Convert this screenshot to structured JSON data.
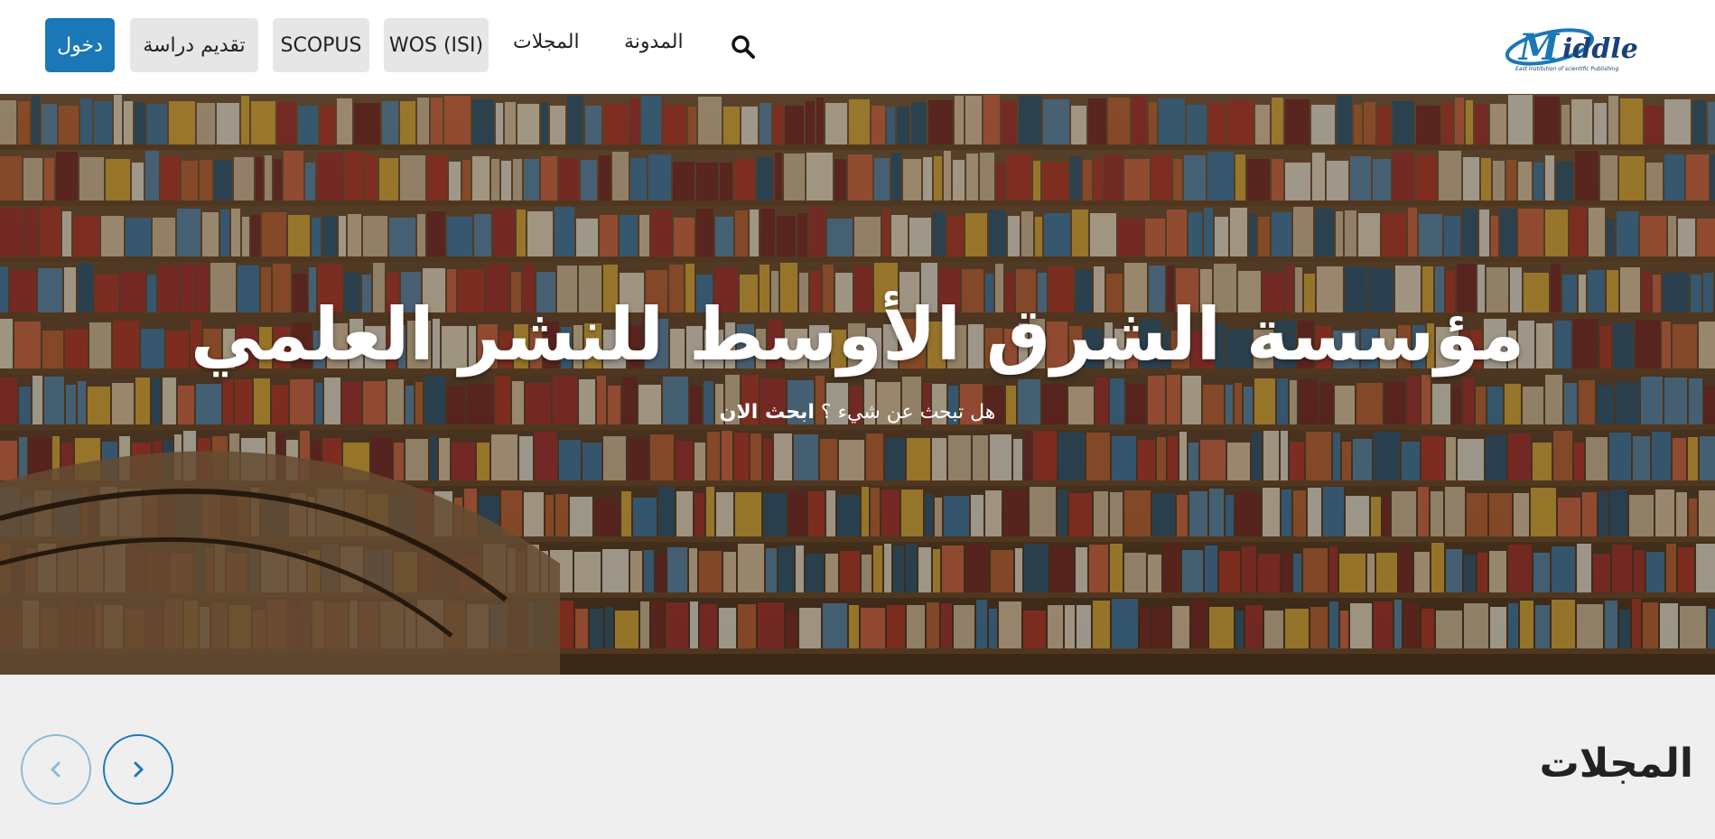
{
  "header": {
    "login_label": "دخول",
    "submit_study_label": "تقديم دراسة",
    "scopus_label": "SCOPUS",
    "wos_label": "WOS (ISI)",
    "journals_label": "المجلات",
    "blog_label": "المدونة",
    "logo_text": "Middle",
    "logo_tagline": "East Institution of scientific Publishing"
  },
  "hero": {
    "title": "مؤسسة الشرق الأوسط للنشر العلمي",
    "subtitle": "هل تبحث عن شيء ؟",
    "search_now": "ابحث الان"
  },
  "section": {
    "title": "المجلات"
  },
  "colors": {
    "primary": "#1b78b8",
    "button_bg": "#e6e6e6",
    "page_bg": "#efefef"
  },
  "icons": {
    "search": "search-icon",
    "prev": "chevron-left-icon",
    "next": "chevron-right-icon"
  }
}
